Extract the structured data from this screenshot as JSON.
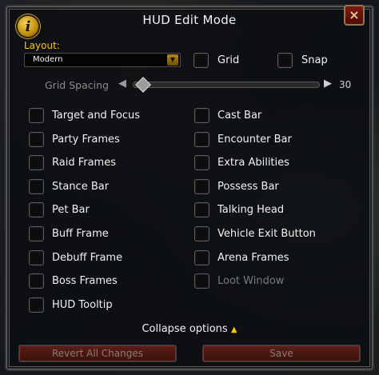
{
  "window": {
    "title": "HUD Edit Mode",
    "info_icon": "i",
    "close_icon": "×"
  },
  "layout": {
    "label": "Layout:",
    "selected": "Modern"
  },
  "top_options": {
    "grid": {
      "label": "Grid",
      "checked": false
    },
    "snap": {
      "label": "Snap",
      "checked": false
    }
  },
  "grid_spacing": {
    "label": "Grid Spacing",
    "value": "30",
    "position_fraction": 0.05,
    "enabled": false
  },
  "left_options": [
    {
      "label": "Target and Focus",
      "checked": false
    },
    {
      "label": "Party Frames",
      "checked": false
    },
    {
      "label": "Raid Frames",
      "checked": false
    },
    {
      "label": "Stance Bar",
      "checked": false
    },
    {
      "label": "Pet Bar",
      "checked": false
    },
    {
      "label": "Buff Frame",
      "checked": false
    },
    {
      "label": "Debuff Frame",
      "checked": false
    },
    {
      "label": "Boss Frames",
      "checked": false
    },
    {
      "label": "HUD Tooltip",
      "checked": false
    }
  ],
  "right_options": [
    {
      "label": "Cast Bar",
      "checked": false,
      "enabled": true
    },
    {
      "label": "Encounter Bar",
      "checked": false,
      "enabled": true
    },
    {
      "label": "Extra Abilities",
      "checked": false,
      "enabled": true
    },
    {
      "label": "Possess Bar",
      "checked": false,
      "enabled": true
    },
    {
      "label": "Talking Head",
      "checked": false,
      "enabled": true
    },
    {
      "label": "Vehicle Exit Button",
      "checked": false,
      "enabled": true
    },
    {
      "label": "Arena Frames",
      "checked": false,
      "enabled": true
    },
    {
      "label": "Loot Window",
      "checked": false,
      "enabled": false
    }
  ],
  "collapse": {
    "label": "Collapse options",
    "arrow": "▲"
  },
  "buttons": {
    "revert": "Revert All Changes",
    "save": "Save"
  },
  "colors": {
    "accent_gold": "#f5c518",
    "button_red": "#5c1e17"
  }
}
